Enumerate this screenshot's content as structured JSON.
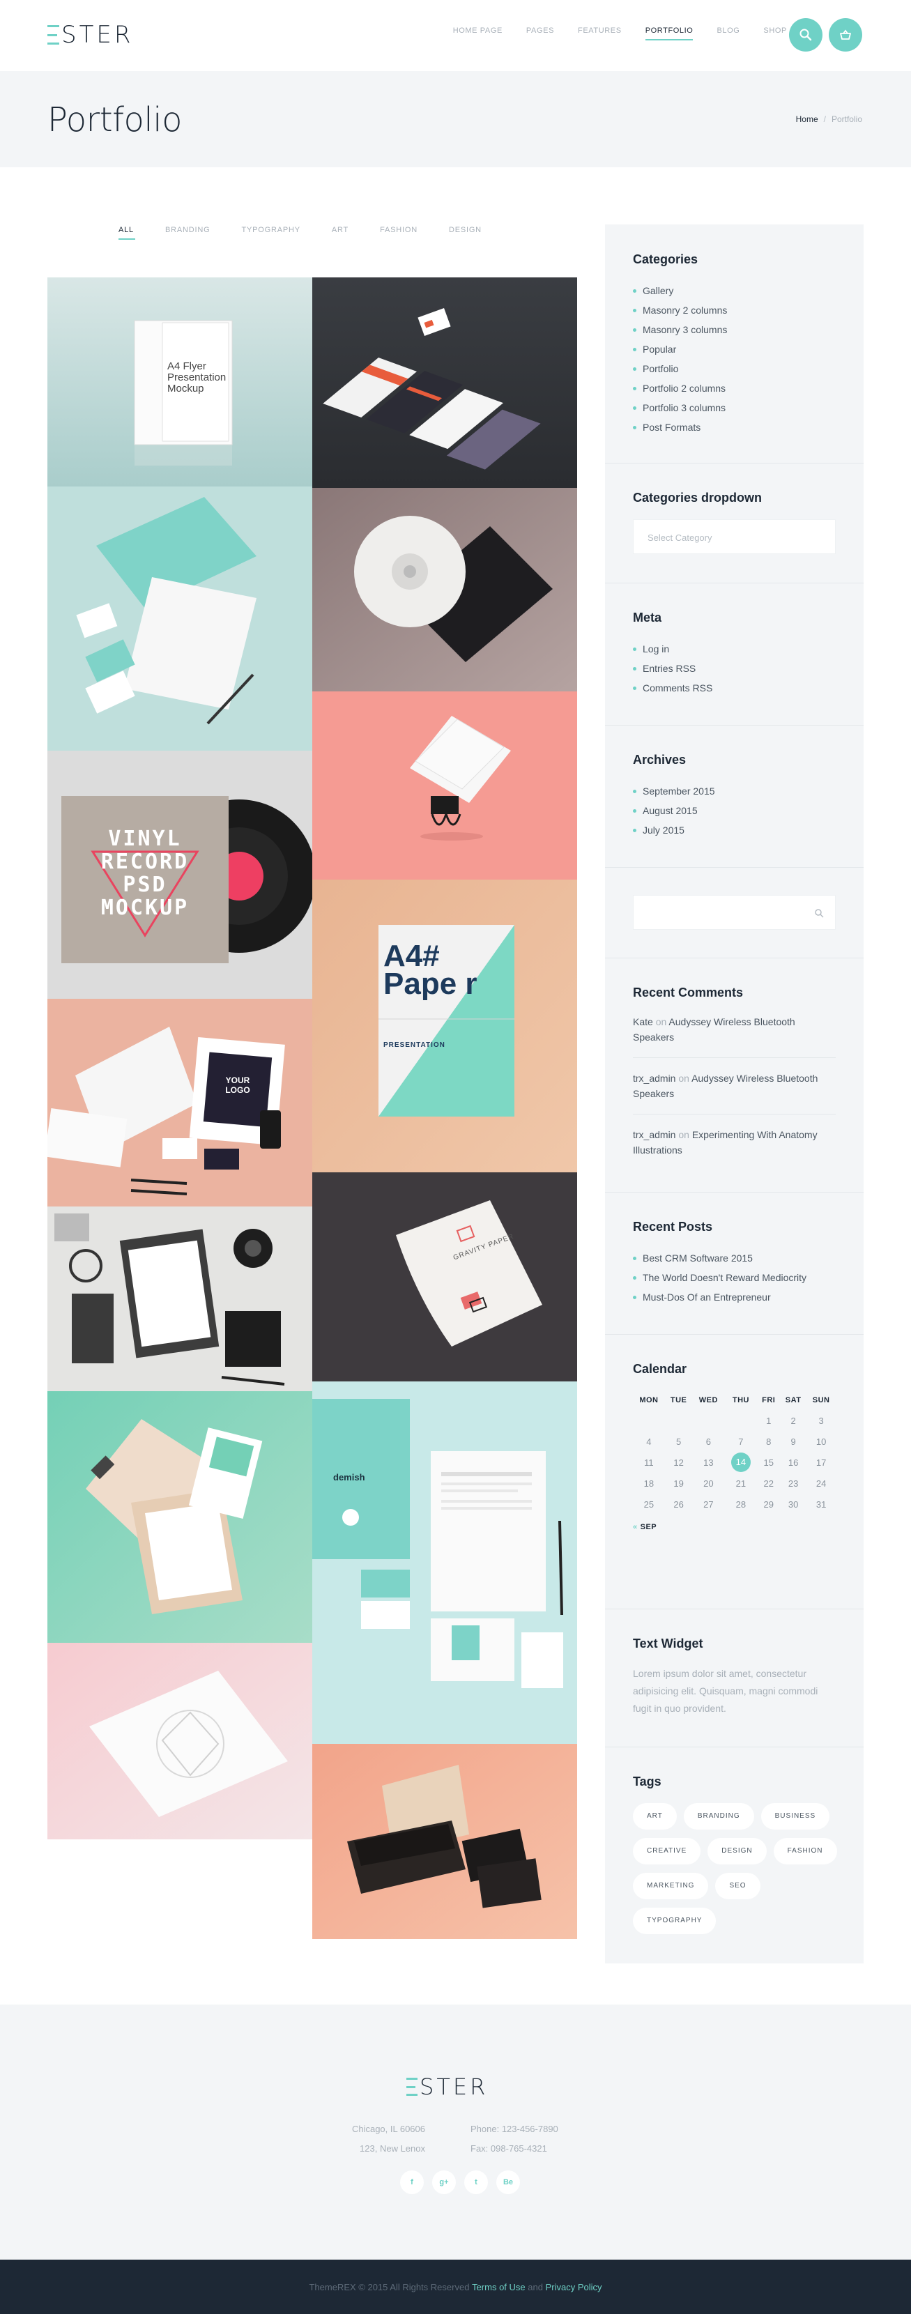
{
  "header": {
    "logo_text": "STER",
    "nav": [
      "HOME PAGE",
      "PAGES",
      "FEATURES",
      "PORTFOLIO",
      "BLOG",
      "SHOP"
    ],
    "active_nav": "PORTFOLIO",
    "search_icon": "search-icon",
    "cart_icon": "basket-icon"
  },
  "title_bar": {
    "title": "Portfolio",
    "breadcrumb_home": "Home",
    "breadcrumb_sep": "/",
    "breadcrumb_current": "Portfolio"
  },
  "filters": [
    "ALL",
    "BRANDING",
    "TYPOGRAPHY",
    "ART",
    "FASHION",
    "DESIGN"
  ],
  "active_filter": "ALL",
  "portfolio_text": {
    "flyer_title": "A4 Flyer Presentation Mockup",
    "vinyl_lines": [
      "VINYL",
      "RECORD",
      "PSD",
      "MOCKUP"
    ],
    "poster_big": "A4# Pape r",
    "poster_small": "PRESENTATION",
    "logo_box": "YOUR LOGO",
    "gravity_paper": "GRAVITY PAPER",
    "demish": "demish"
  },
  "sidebar": {
    "categories": {
      "title": "Categories",
      "items": [
        "Gallery",
        "Masonry 2 columns",
        "Masonry 3 columns",
        "Popular",
        "Portfolio",
        "Portfolio 2 columns",
        "Portfolio 3 columns",
        "Post Formats"
      ]
    },
    "categories_dropdown": {
      "title": "Categories dropdown",
      "placeholder": "Select Category"
    },
    "meta": {
      "title": "Meta",
      "items": [
        "Log in",
        "Entries RSS",
        "Comments RSS"
      ]
    },
    "archives": {
      "title": "Archives",
      "items": [
        "September 2015",
        "August 2015",
        "July 2015"
      ]
    },
    "recent_comments": {
      "title": "Recent Comments",
      "items": [
        {
          "author": "Kate",
          "on": "on",
          "post": "Audyssey Wireless Bluetooth Speakers"
        },
        {
          "author": "trx_admin",
          "on": "on",
          "post": "Audyssey Wireless Bluetooth Speakers"
        },
        {
          "author": "trx_admin",
          "on": "on",
          "post": "Experimenting With Anatomy Illustrations"
        }
      ]
    },
    "recent_posts": {
      "title": "Recent Posts",
      "items": [
        "Best CRM Software 2015",
        "The World Doesn't Reward Mediocrity",
        "Must-Dos Of an Entrepreneur"
      ]
    },
    "calendar": {
      "title": "Calendar",
      "days": [
        "MON",
        "TUE",
        "WED",
        "THU",
        "FRI",
        "SAT",
        "SUN"
      ],
      "weeks": [
        [
          "",
          "",
          "",
          "",
          "1",
          "2",
          "3"
        ],
        [
          "4",
          "5",
          "6",
          "7",
          "8",
          "9",
          "10"
        ],
        [
          "11",
          "12",
          "13",
          "14",
          "15",
          "16",
          "17"
        ],
        [
          "18",
          "19",
          "20",
          "21",
          "22",
          "23",
          "24"
        ],
        [
          "25",
          "26",
          "27",
          "28",
          "29",
          "30",
          "31"
        ]
      ],
      "today": "14",
      "prev_label": "SEP",
      "prev_arrow": "«"
    },
    "text_widget": {
      "title": "Text Widget",
      "text": "Lorem ipsum dolor sit amet, consectetur adipisicing elit. Quisquam, magni commodi fugit in quo provident."
    },
    "tags": {
      "title": "Tags",
      "items": [
        "ART",
        "BRANDING",
        "BUSINESS",
        "CREATIVE",
        "DESIGN",
        "FASHION",
        "MARKETING",
        "SEO",
        "TYPOGRAPHY"
      ]
    }
  },
  "footer": {
    "logo_text": "STER",
    "address_1": "Chicago, IL 60606",
    "address_2": "123, New Lenox",
    "phone": "Phone: 123-456-7890",
    "fax": "Fax: 098-765-4321",
    "socials": [
      "f",
      "g+",
      "t",
      "Be"
    ],
    "copyright": "ThemeREX © 2015 All Rights Reserved",
    "terms": "Terms of Use",
    "and": "and",
    "privacy": "Privacy Policy"
  },
  "colors": {
    "accent": "#6fd1c6",
    "dark": "#1d2835",
    "muted": "#a8b0b8",
    "panel": "#f3f5f7"
  }
}
